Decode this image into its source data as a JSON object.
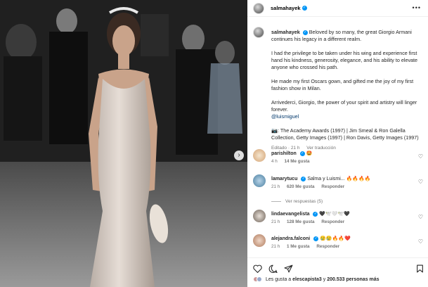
{
  "post": {
    "username": "salmahayek",
    "more_icon": "more-options-icon",
    "caption": {
      "p1": "Beloved by so many, the great Giorgio Armani continues his legacy in a different realm.",
      "p2": "I had the privilege to be taken under his wing and experience first hand his kindness, generosity, elegance, and his ability to elevate anyone who crossed his path.",
      "p3": "He made my first Oscars gown, and gifted me the joy of my first fashion show in Milan.",
      "p4": "Arrivederci, Giorgio, the power of your spirit and artistry will linger forever.",
      "mention": "@luismiguel",
      "credit": "📷: The Academy Awards (1997) | Jim Smeal & Ron Galella Collection, Getty Images (1997) | Ron Davis, Getty Images (1997)",
      "edited": "Editado · 21 h",
      "see_translation": "Ver traducción"
    }
  },
  "comments": [
    {
      "user": "parishilton",
      "text": "🤩",
      "time": "4 h",
      "likes": "14 Me gusta",
      "reply": ""
    },
    {
      "user": "lamarytucu",
      "text": "Salma y Luismi... 🔥🔥🔥🔥",
      "time": "21 h",
      "likes": "620 Me gusta",
      "reply": "Responder"
    },
    {
      "user": "lindaevangelista",
      "text": "🖤🕊️🤍🕊️🖤",
      "time": "21 h",
      "likes": "128 Me gusta",
      "reply": "Responder"
    },
    {
      "user": "alejandra.falconi",
      "text": "😢😢🔥🔥❤️",
      "time": "21 h",
      "likes": "1 Me gusta",
      "reply": "Responder"
    }
  ],
  "view_replies": "Ver respuestas (5)",
  "likes_line": {
    "prefix": "Les gusta a",
    "user": "elescapista3",
    "middle": "y",
    "count": "200.533 personas más"
  },
  "colors": {
    "verified": "#0095f6",
    "mention": "#00376b",
    "meta": "#737373"
  }
}
